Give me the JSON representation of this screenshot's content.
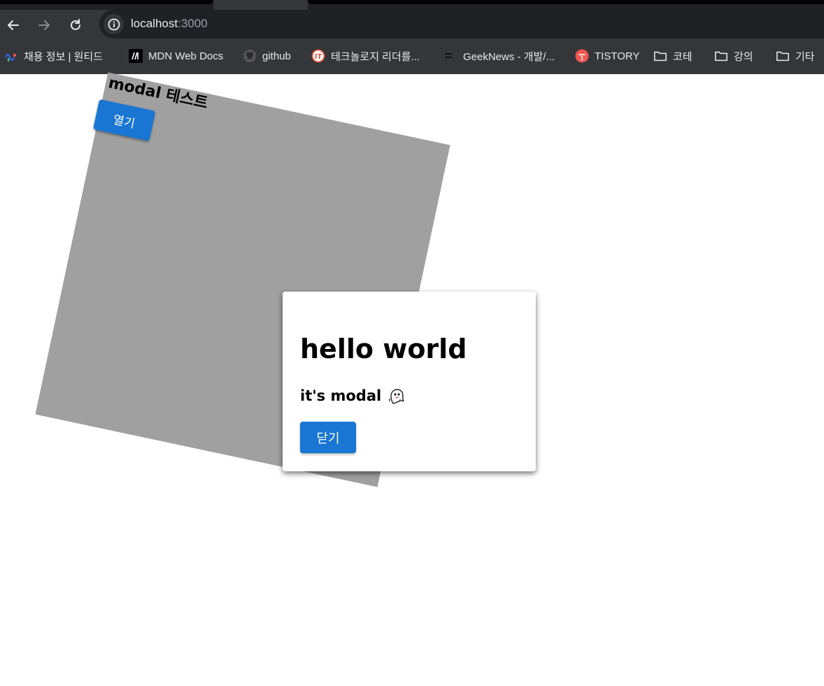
{
  "browser": {
    "url_host": "localhost",
    "url_port": ":3000",
    "bookmarks": [
      {
        "label": "채용 정보 | 원티드",
        "icon": "wanted-icon"
      },
      {
        "label": "MDN Web Docs",
        "icon": "mdn-icon"
      },
      {
        "label": "github",
        "icon": "github-icon"
      },
      {
        "label": "테크놀로지 리더를...",
        "icon": "it-icon"
      },
      {
        "label": "GeekNews - 개발/...",
        "icon": "geeknews-icon"
      },
      {
        "label": "TISTORY",
        "icon": "tistory-icon"
      },
      {
        "label": "코테",
        "icon": "folder-icon"
      },
      {
        "label": "강의",
        "icon": "folder-icon"
      },
      {
        "label": "기타",
        "icon": "folder-icon"
      }
    ]
  },
  "page": {
    "title": "modal 테스트",
    "open_label": "열기"
  },
  "modal": {
    "heading": "hello world",
    "subtitle": "it's modal",
    "close_label": "닫기"
  },
  "colors": {
    "accent": "#1976d2",
    "box": "#a0a0a0"
  }
}
